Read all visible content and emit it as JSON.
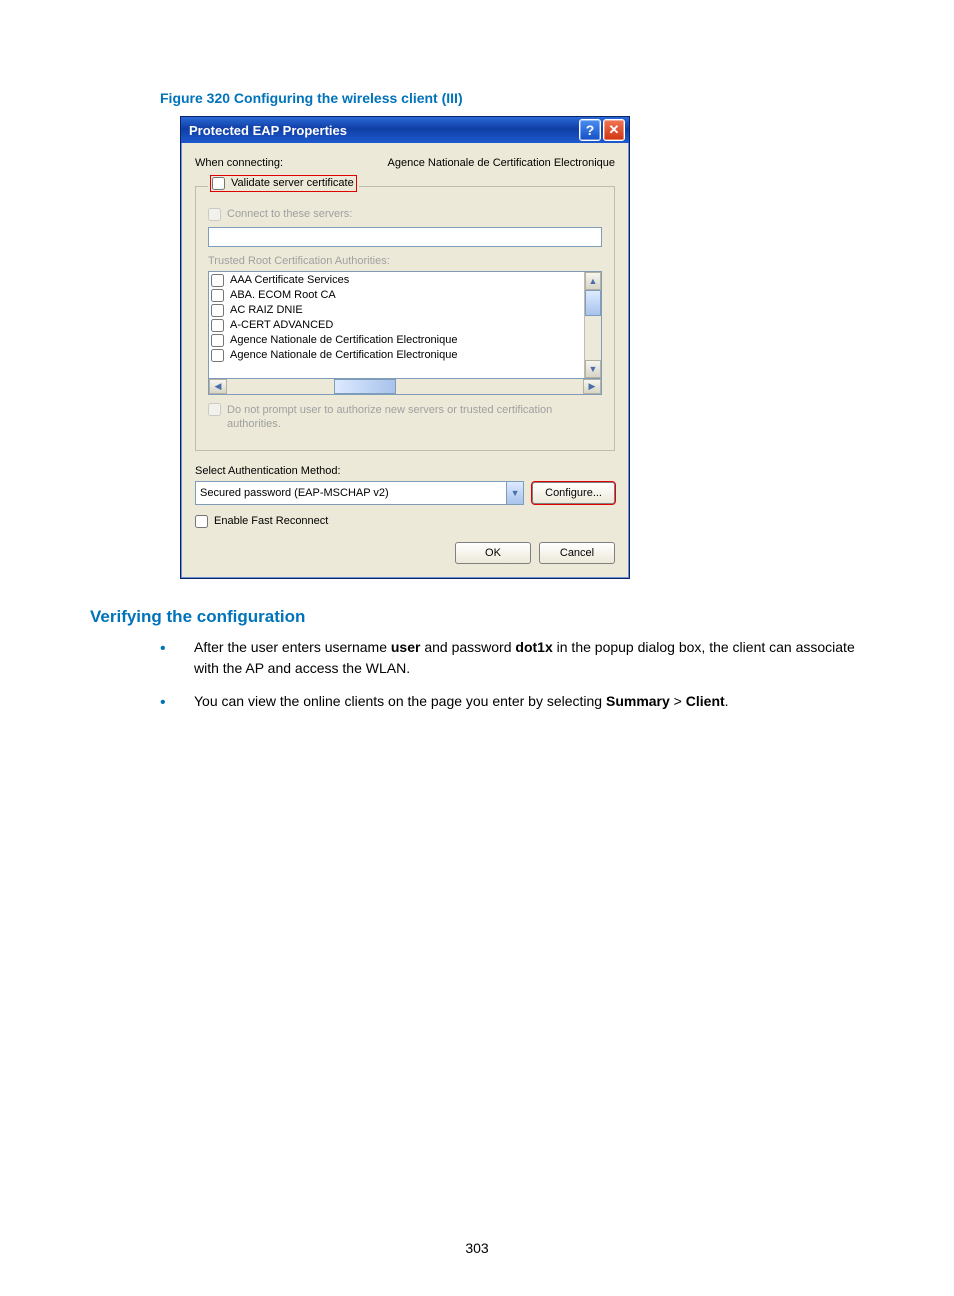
{
  "figure_caption": "Figure 320 Configuring the wireless client (III)",
  "dialog": {
    "title": "Protected EAP Properties",
    "when_connecting_label": "When connecting:",
    "when_connecting_value": "Agence Nationale de Certification Electronique",
    "validate_server_cert": "Validate server certificate",
    "connect_to_servers": "Connect to these servers:",
    "trusted_root_label": "Trusted Root Certification Authorities:",
    "ca_list": [
      "AAA Certificate Services",
      "ABA. ECOM Root CA",
      "AC RAIZ DNIE",
      "A-CERT ADVANCED",
      "Agence Nationale de Certification Electronique",
      "Agence Nationale de Certification Electronique"
    ],
    "do_not_prompt": "Do not prompt user to authorize new servers or trusted certification authorities.",
    "select_auth_label": "Select Authentication Method:",
    "auth_method_value": "Secured password (EAP-MSCHAP v2)",
    "configure_btn": "Configure...",
    "fast_reconnect": "Enable Fast Reconnect",
    "ok": "OK",
    "cancel": "Cancel"
  },
  "section_heading": "Verifying the configuration",
  "bullets": {
    "b1_pre": "After the user enters username ",
    "b1_user": "user",
    "b1_mid": " and password ",
    "b1_pw": "dot1x",
    "b1_post": " in the popup dialog box, the client can associate with the AP and access the WLAN.",
    "b2_pre": "You can view the online clients on the page you enter by selecting ",
    "b2_summary": "Summary",
    "b2_gt": " > ",
    "b2_client": "Client",
    "b2_post": "."
  },
  "page_number": "303"
}
